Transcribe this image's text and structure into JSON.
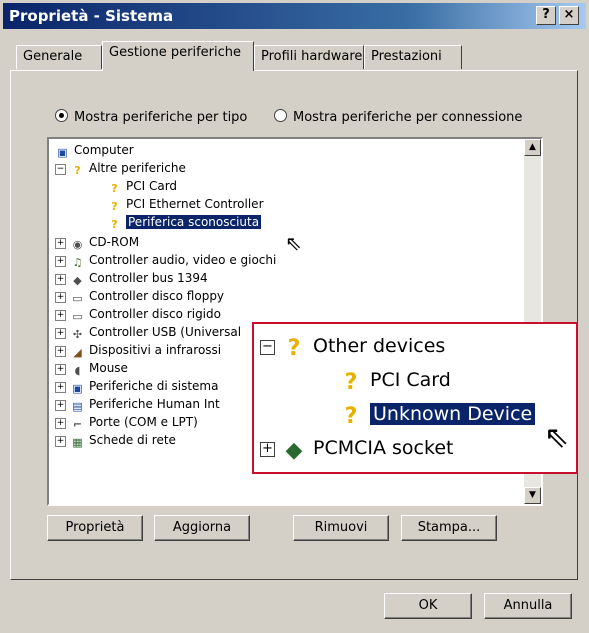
{
  "window": {
    "title": "Proprietà - Sistema",
    "help_button": "?",
    "close_button": "×"
  },
  "tabs": [
    {
      "label": "Generale"
    },
    {
      "label": "Gestione periferiche"
    },
    {
      "label": "Profili hardware"
    },
    {
      "label": "Prestazioni"
    }
  ],
  "view_options": {
    "by_type": "Mostra periferiche per tipo",
    "by_connection": "Mostra periferiche per connessione",
    "selected": "by_type"
  },
  "tree": {
    "root": "Computer",
    "other_devices": "Altre periferiche",
    "other_children": [
      "PCI Card",
      "PCI Ethernet Controller",
      "Periferica sconosciuta"
    ],
    "categories": [
      "CD-ROM",
      "Controller audio, video e giochi",
      "Controller bus 1394",
      "Controller disco floppy",
      "Controller disco rigido",
      "Controller USB (Universal",
      "Dispositivi a infrarossi",
      "Mouse",
      "Periferiche di sistema",
      "Periferiche Human Int",
      "Porte (COM e LPT)",
      "Schede di rete"
    ]
  },
  "buttons": {
    "properties": "Proprietà",
    "refresh": "Aggiorna",
    "remove": "Rimuovi",
    "print": "Stampa...",
    "ok": "OK",
    "cancel": "Annulla"
  },
  "zoom_inset": {
    "other_devices": "Other devices",
    "pci_card": "PCI Card",
    "unknown_device": "Unknown Device",
    "pcmcia_socket": "PCMCIA socket"
  }
}
